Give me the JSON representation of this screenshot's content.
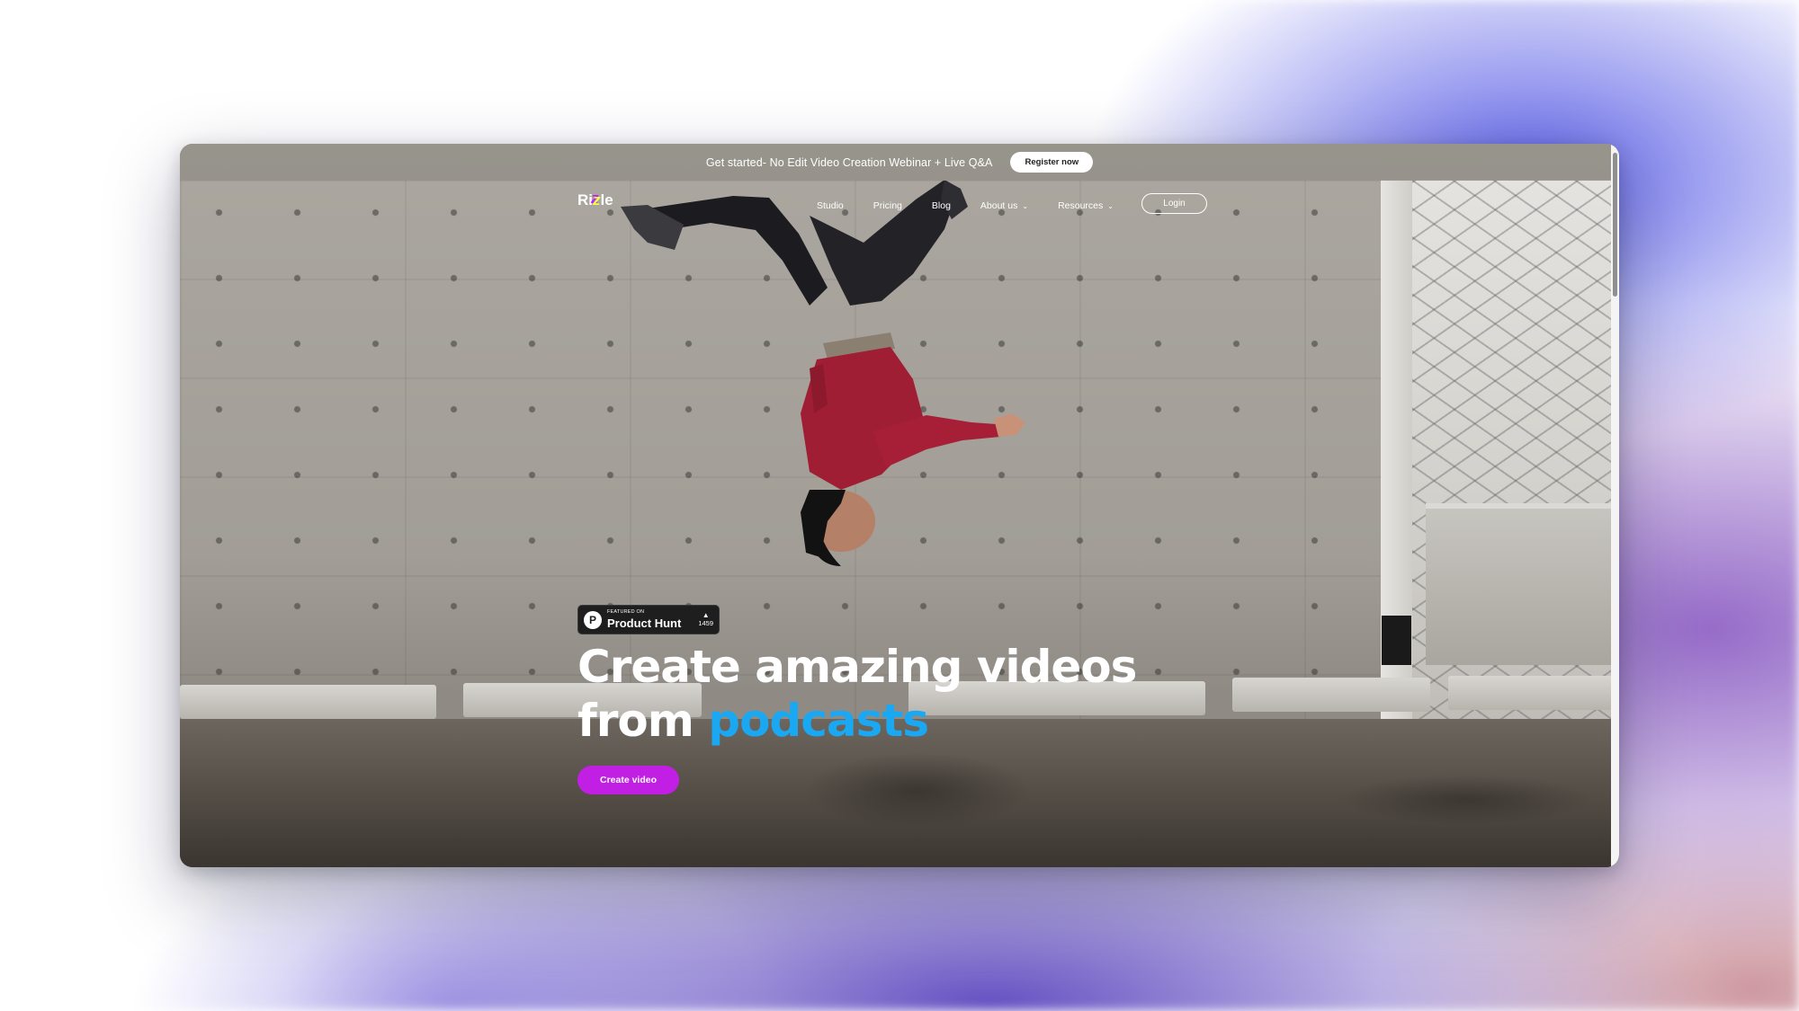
{
  "banner": {
    "text": "Get started- No Edit Video Creation Webinar + Live Q&A",
    "button_label": "Register now"
  },
  "nav": {
    "logo": {
      "prefix": "Ri",
      "mark": "z",
      "suffix": "le"
    },
    "links": [
      {
        "label": "Studio",
        "has_dropdown": false
      },
      {
        "label": "Pricing",
        "has_dropdown": false
      },
      {
        "label": "Blog",
        "has_dropdown": false
      },
      {
        "label": "About us",
        "has_dropdown": true
      },
      {
        "label": "Resources",
        "has_dropdown": true
      }
    ],
    "login_label": "Login"
  },
  "badge": {
    "featured_on": "FEATURED ON",
    "name": "Product Hunt",
    "logo_letter": "P",
    "votes": "1459"
  },
  "hero": {
    "headline_line1": "Create amazing videos",
    "headline_line2_prefix": "from ",
    "headline_line2_accent": "podcasts",
    "cta_label": "Create video"
  },
  "colors": {
    "accent_blue": "#1aa8f2",
    "cta_purple": "#c21fe5",
    "logo_yellow": "#f3ff45",
    "logo_magenta": "#c81aff"
  },
  "icons": {
    "dropdown": "chevron-down-icon",
    "upvote": "upvote-triangle-icon"
  }
}
